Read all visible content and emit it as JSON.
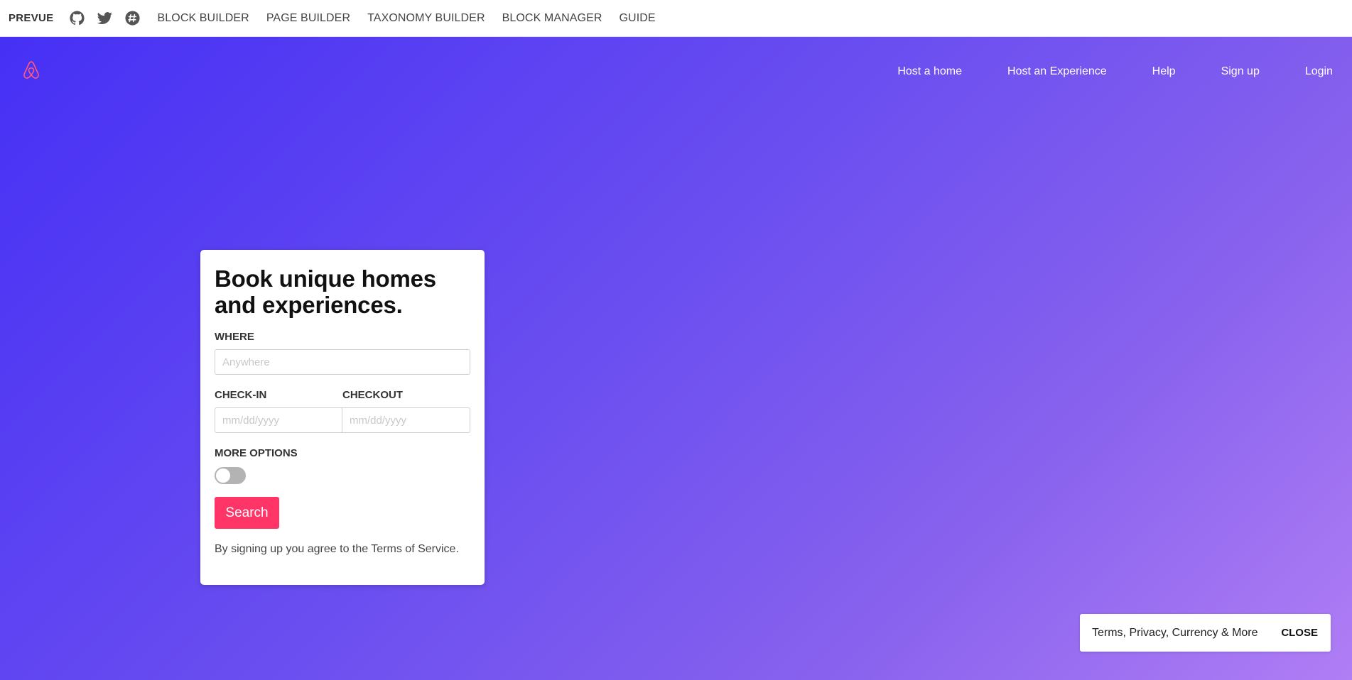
{
  "topbar": {
    "brand": "PREVUE",
    "icons": [
      "github-icon",
      "twitter-icon",
      "slack-icon"
    ],
    "links": [
      "BLOCK BUILDER",
      "PAGE BUILDER",
      "TAXONOMY BUILDER",
      "BLOCK MANAGER",
      "GUIDE"
    ]
  },
  "site": {
    "logo_icon": "airbnb-logo-icon",
    "nav": [
      "Host a home",
      "Host an Experience",
      "Help",
      "Sign up",
      "Login"
    ]
  },
  "form": {
    "title": "Book unique homes and experiences.",
    "where_label": "WHERE",
    "where_placeholder": "Anywhere",
    "checkin_label": "CHECK-IN",
    "checkin_placeholder": "mm/dd/yyyy",
    "checkout_label": "CHECKOUT",
    "checkout_placeholder": "mm/dd/yyyy",
    "more_options_label": "MORE OPTIONS",
    "more_options_on": false,
    "search_label": "Search",
    "terms_text": "By signing up you agree to the Terms of Service."
  },
  "footer": {
    "links_text": "Terms, Privacy, Currency & More",
    "close_label": "CLOSE"
  },
  "colors": {
    "accent": "#ff3568",
    "hero_gradient_start": "#4630f5",
    "hero_gradient_end": "#b07ef5",
    "logo": "#ff5a7a"
  }
}
